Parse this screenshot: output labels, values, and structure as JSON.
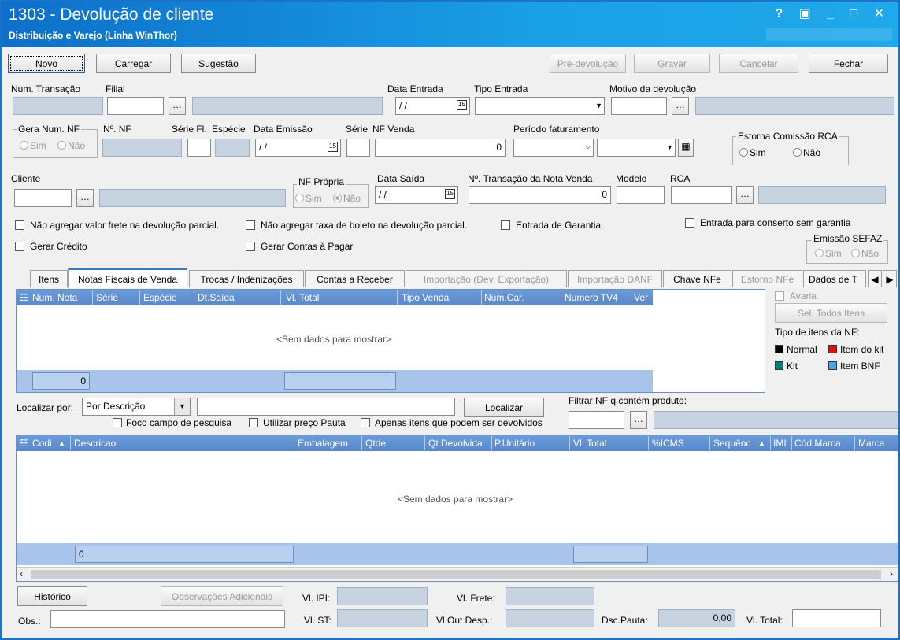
{
  "window": {
    "title": "1303 - Devolução de cliente",
    "subtitle": "Distribuição e Varejo (Linha WinThor)",
    "controls": "? ▣ _ □ ✕"
  },
  "toolbar": {
    "novo": "Novo",
    "carregar": "Carregar",
    "sugestao": "Sugestão",
    "pre_devolucao": "Pré-devolução",
    "gravar": "Gravar",
    "cancelar": "Cancelar",
    "fechar": "Fechar"
  },
  "header": {
    "num_transacao": "Num. Transação",
    "filial": "Filial",
    "data_entrada": "Data Entrada",
    "data_entrada_value": "/ /",
    "tipo_entrada": "Tipo Entrada",
    "motivo_devolucao": "Motivo da devolução",
    "gera_num_nf": "Gera Num. NF",
    "sim": "Sim",
    "nao": "Não",
    "num_nf": "Nº. NF",
    "serie_fl": "Série Fl.",
    "especie": "Espécie",
    "data_emissao": "Data Emissão",
    "data_emissao_value": "/ /",
    "serie": "Série",
    "nf_venda": "NF Venda",
    "nf_venda_value": "0",
    "periodo_faturamento": "Período faturamento",
    "estorna_comissao": "Estorna Comissão RCA",
    "cliente": "Cliente",
    "nf_propria": "NF Própria",
    "data_saida": "Data Saída",
    "data_saida_value": "/ /",
    "num_transacao_nota_venda": "Nº. Transação da Nota Venda",
    "num_transacao_nota_venda_value": "0",
    "modelo": "Modelo",
    "rca": "RCA"
  },
  "options": {
    "nao_agregar_frete": "Não agregar valor frete na devolução parcial.",
    "nao_agregar_taxa": "Não agregar taxa de boleto na devolução parcial.",
    "entrada_garantia": "Entrada de Garantia",
    "entrada_conserto": "Entrada para conserto sem garantia",
    "gerar_credito": "Gerar Crédito",
    "gerar_contas_pagar": "Gerar Contas à Pagar",
    "emissao_sefaz": "Emissão SEFAZ"
  },
  "tabs": [
    {
      "label": "Itens"
    },
    {
      "label": "Notas Fiscais de Venda"
    },
    {
      "label": "Trocas / Indenizações"
    },
    {
      "label": "Contas a Receber"
    },
    {
      "label": "Importação (Dev. Exportação)"
    },
    {
      "label": "Importação DANF"
    },
    {
      "label": "Chave NFe"
    },
    {
      "label": "Estorno NFe"
    },
    {
      "label": "Dados de T"
    }
  ],
  "nf_grid": {
    "columns": [
      "Num. Nota",
      "Série",
      "Espécie",
      "Dt.Saída",
      "Vl. Total",
      "Tipo Venda",
      "Num.Car.",
      "Numero TV4",
      "Ver"
    ],
    "empty": "<Sem dados para mostrar>",
    "footer_count": "0"
  },
  "side": {
    "avaria": "Avaria",
    "sel_todos": "Sel. Todos Itens",
    "tipo_itens": "Tipo de itens da NF:",
    "legend": [
      {
        "label": "Normal",
        "color": "#000000"
      },
      {
        "label": "Item do kit",
        "color": "#e01010"
      },
      {
        "label": "Kit",
        "color": "#0b7d7a"
      },
      {
        "label": "Item BNF",
        "color": "#4da3f0"
      }
    ]
  },
  "search": {
    "localizar_por": "Localizar por:",
    "por_descricao": "Por Descrição",
    "localizar_btn": "Localizar",
    "filtrar_nf": "Filtrar NF q contém produto:",
    "foco_campo": "Foco campo de pesquisa",
    "utilizar_preco": "Utilizar preço Pauta",
    "apenas_itens": "Apenas itens que podem ser devolvidos"
  },
  "items_grid": {
    "columns": [
      "Codi",
      "Descricao",
      "Embalagem",
      "Qtde",
      "Qt Devolvida",
      "P.Unitário",
      "Vl. Total",
      "%ICMS",
      "Sequênc",
      "IMI",
      "Cód.Marca",
      "Marca"
    ],
    "empty": "<Sem dados para mostrar>",
    "footer_count": "0"
  },
  "footer": {
    "historico": "Histórico",
    "observacoes": "Observações Adicionais",
    "vl_ipi": "Vl. IPI:",
    "vl_frete": "Vl. Frete:",
    "obs": "Obs.:",
    "vl_st": "Vl. ST:",
    "vl_out_desp": "Vl.Out.Desp.:",
    "dsc_pauta": "Dsc.Pauta:",
    "dsc_pauta_value": "0,00",
    "vl_total": "Vl. Total:"
  }
}
